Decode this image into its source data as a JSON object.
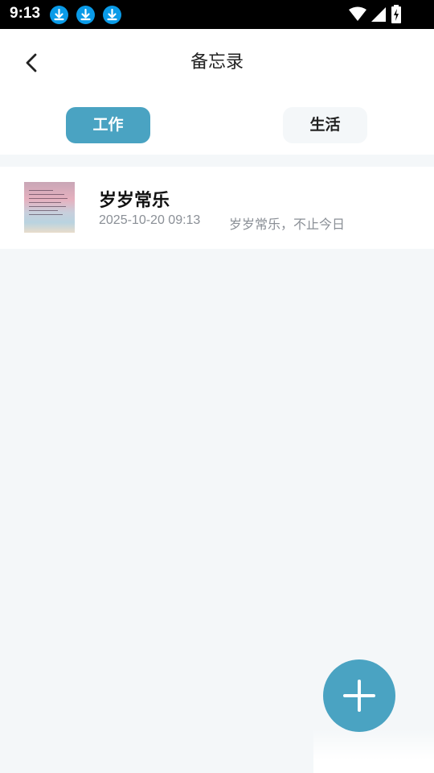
{
  "status_bar": {
    "time": "9:13",
    "icons": [
      "download-icon",
      "download-icon",
      "download-icon",
      "wifi-icon",
      "signal-icon",
      "battery-charging-icon"
    ]
  },
  "header": {
    "title": "备忘录",
    "back_icon": "chevron-left-icon"
  },
  "tabs": [
    {
      "label": "工作",
      "selected": true
    },
    {
      "label": "生活",
      "selected": false
    }
  ],
  "notes": [
    {
      "title": "岁岁常乐",
      "time": "2025-10-20 09:13",
      "preview": "岁岁常乐，不止今日"
    }
  ],
  "fab": {
    "icon": "plus-icon"
  },
  "colors": {
    "accent": "#4aa3c2",
    "background": "#f4f7f9",
    "secondary_text": "#8a8f96"
  }
}
